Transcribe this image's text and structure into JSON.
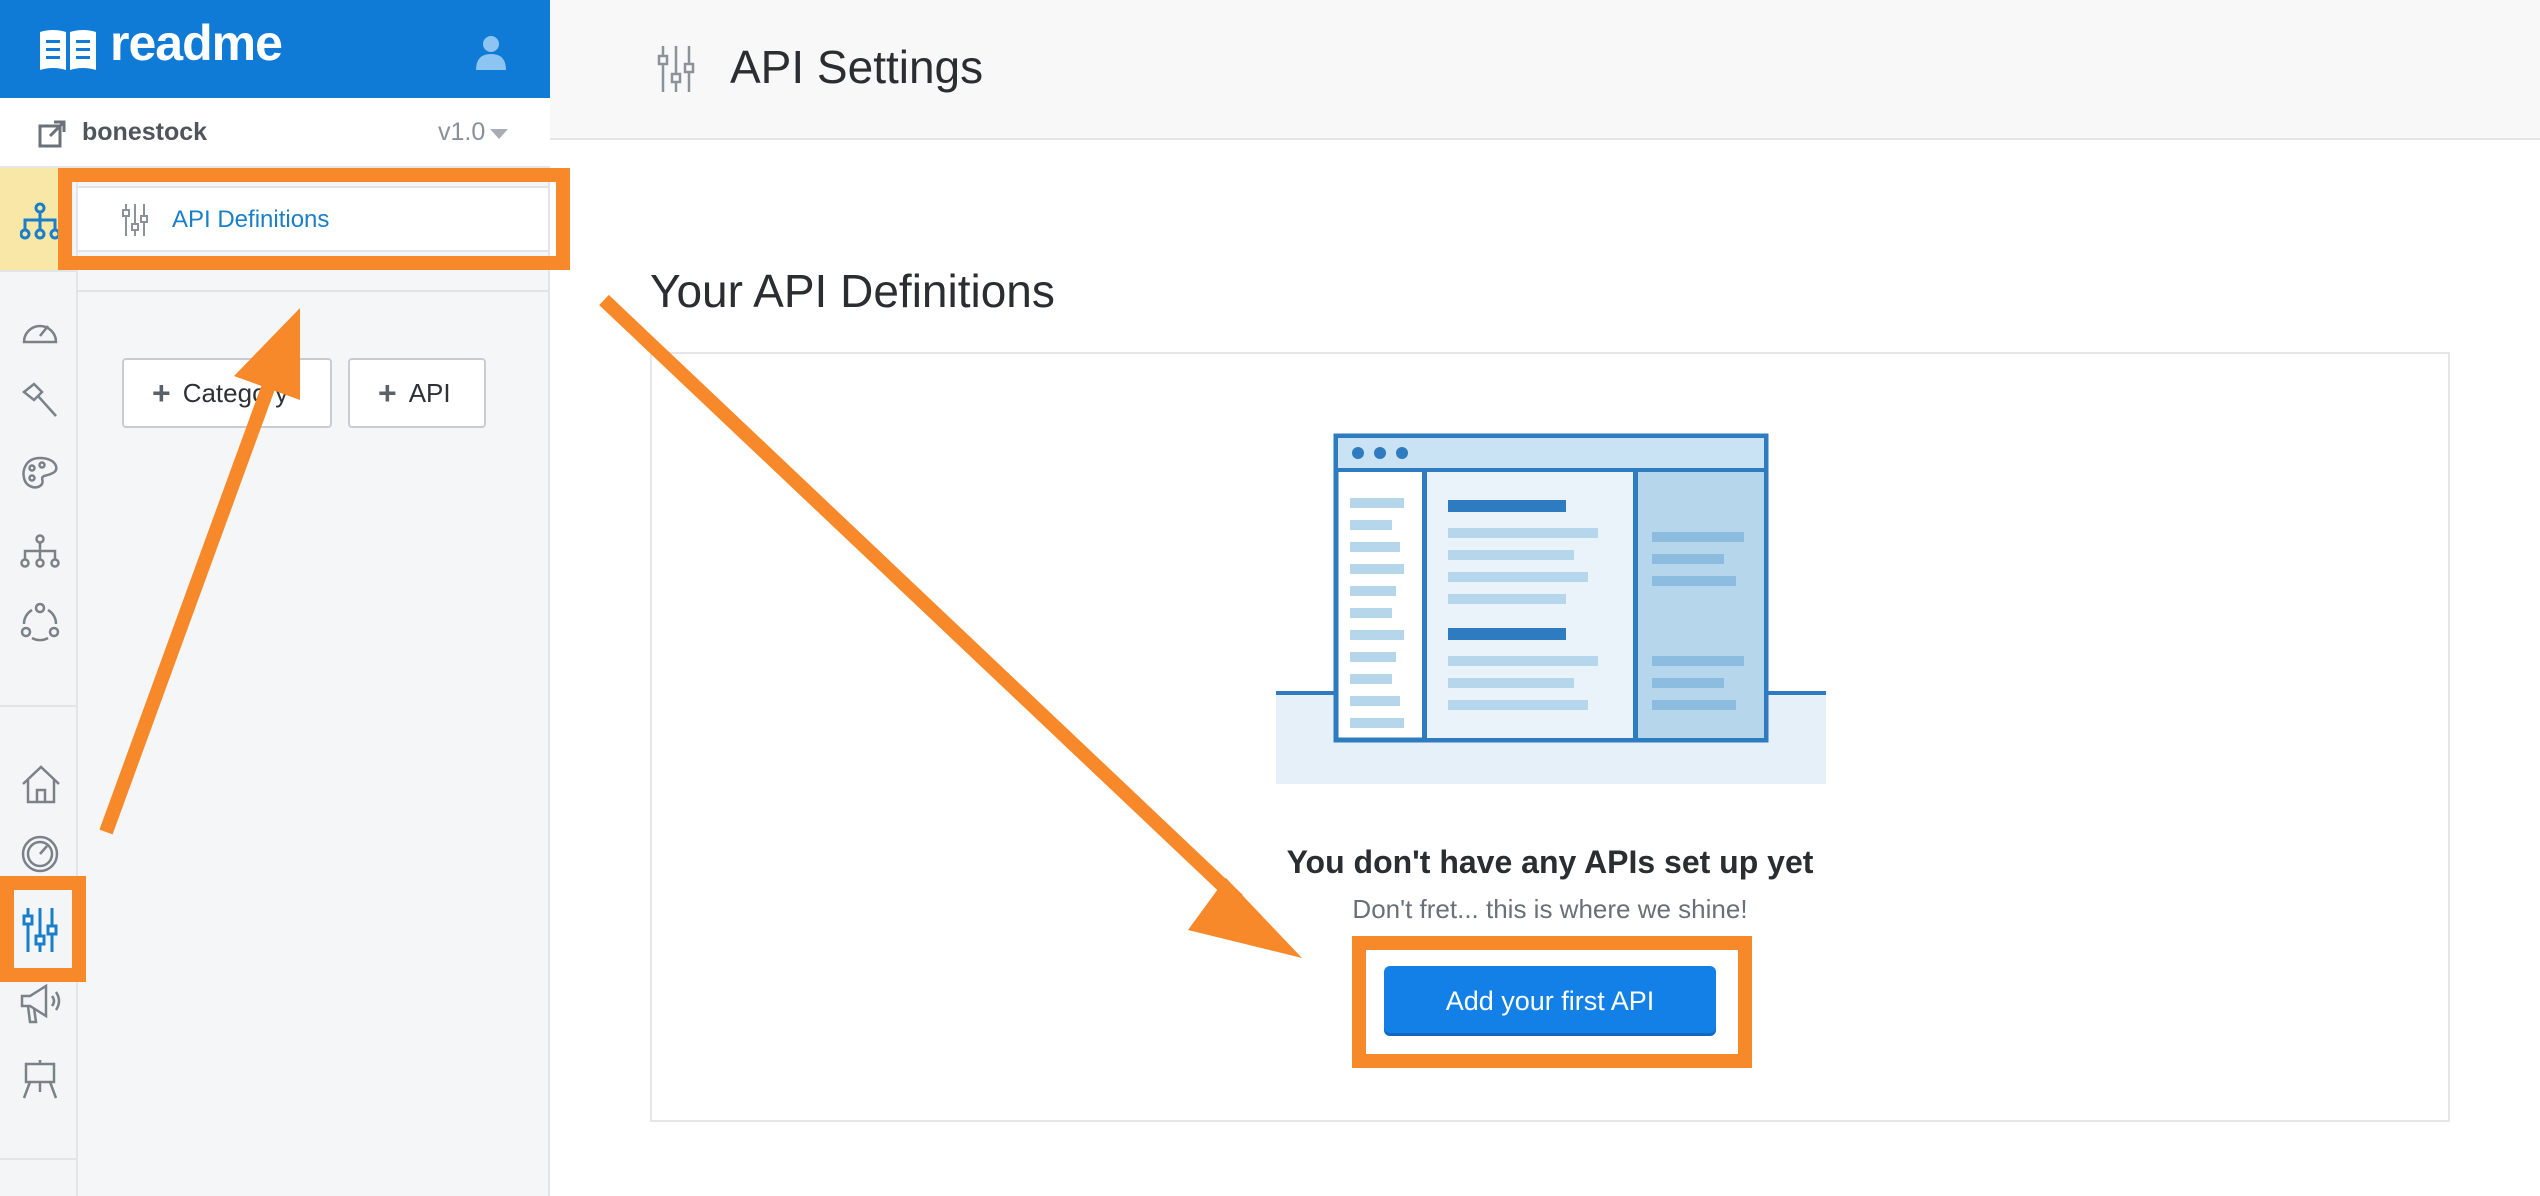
{
  "brand": {
    "logo_text": "readme"
  },
  "project": {
    "name": "bonestock",
    "version": "v1.0"
  },
  "sidebar": {
    "rail_icons": [
      "api-reference-icon",
      "metrics-icon",
      "hammer-icon",
      "palette-icon",
      "hierarchy-icon",
      "users-icon",
      "home-icon",
      "speedometer-icon",
      "sliders-icon",
      "megaphone-icon",
      "easel-icon"
    ],
    "nav_item": {
      "label": "API Definitions",
      "icon": "sliders-icon"
    },
    "add_category_label": "Category",
    "add_api_label": "API"
  },
  "header": {
    "title": "API Settings",
    "icon": "sliders-icon"
  },
  "main": {
    "section_title": "Your API Definitions",
    "empty_title": "You don't have any APIs set up yet",
    "empty_subtitle": "Don't fret... this is where we shine!",
    "cta_label": "Add your first API"
  },
  "colors": {
    "brand_blue": "#0f7bd6",
    "button_blue": "#1380e8",
    "highlight_orange": "#f7892a",
    "active_rail_yellow": "#f9e7a8"
  }
}
